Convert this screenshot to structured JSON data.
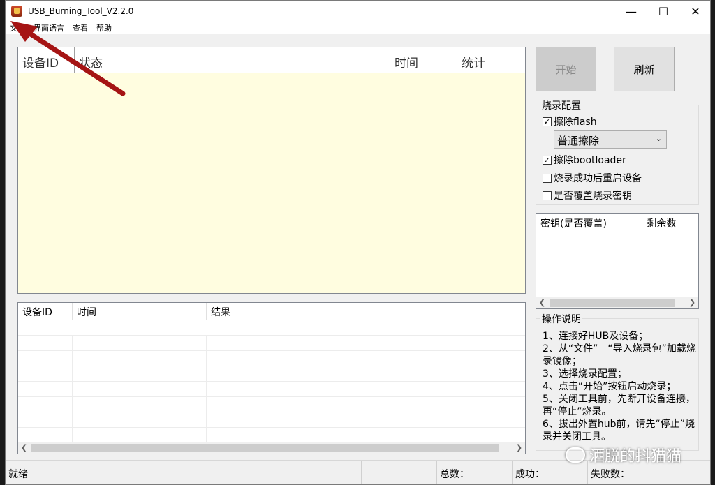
{
  "window": {
    "title": "USB_Burning_Tool_V2.2.0"
  },
  "menu": {
    "items": [
      "文件",
      "界面语言",
      "查看",
      "帮助"
    ]
  },
  "device_grid": {
    "columns": [
      "设备ID",
      "状态",
      "时间",
      "统计"
    ]
  },
  "log_grid": {
    "columns": [
      "设备ID",
      "时间",
      "结果"
    ]
  },
  "buttons": {
    "start": "开始",
    "refresh": "刷新"
  },
  "burn_config": {
    "title": "烧录配置",
    "erase_flash": {
      "label": "擦除flash",
      "checked": true
    },
    "erase_mode": {
      "value": "普通擦除"
    },
    "erase_bootloader": {
      "label": "擦除bootloader",
      "checked": true
    },
    "reboot_after": {
      "label": "烧录成功后重启设备",
      "checked": false
    },
    "overwrite_key": {
      "label": "是否覆盖烧录密钥",
      "checked": false
    }
  },
  "key_list": {
    "columns": [
      "密钥(是否覆盖)",
      "剩余数"
    ]
  },
  "instructions": {
    "title": "操作说明",
    "text": "1、连接好HUB及设备；\n2、从“文件”－“导入烧录包”加载烧录镜像；\n3、选择烧录配置；\n4、点击“开始”按钮启动烧录；\n5、关闭工具前，先断开设备连接，再“停止”烧录。\n6、拔出外置hub前，请先“停止”烧录并关闭工具。"
  },
  "status_bar": {
    "ready": "就绪",
    "total": "总数：",
    "success": "成功：",
    "fail": "失败数："
  },
  "watermark": {
    "text": "洒脱的抖猫猫"
  },
  "colors": {
    "arrow": "#a51414",
    "grid_background": "#fffde0"
  }
}
